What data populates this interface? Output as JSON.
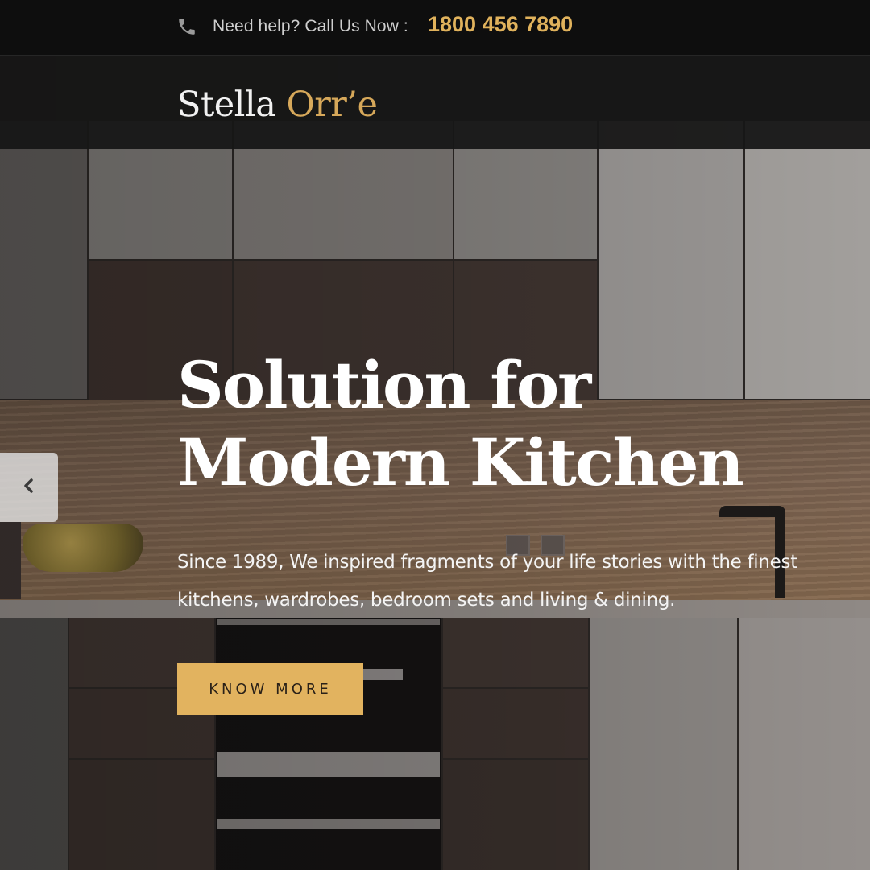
{
  "topbar": {
    "help_text": "Need help? Call Us Now :",
    "phone_number": "1800 456 7890"
  },
  "header": {
    "logo_part1": "Stella",
    "logo_part2": "Orr’e"
  },
  "hero": {
    "headline_line1": "Solution for",
    "headline_line2": "Modern Kitchen",
    "subtext": "Since 1989, We inspired fragments of your life stories with the finest kitchens, wardrobes, bedroom sets and living & dining.",
    "cta_label": "KNOW MORE"
  },
  "icons": {
    "phone": "phone-icon",
    "prev": "chevron-left-icon"
  },
  "colors": {
    "accent": "#e2b35f",
    "topbar_bg": "#0e0e0e",
    "logo_accent": "#d6a85a"
  }
}
